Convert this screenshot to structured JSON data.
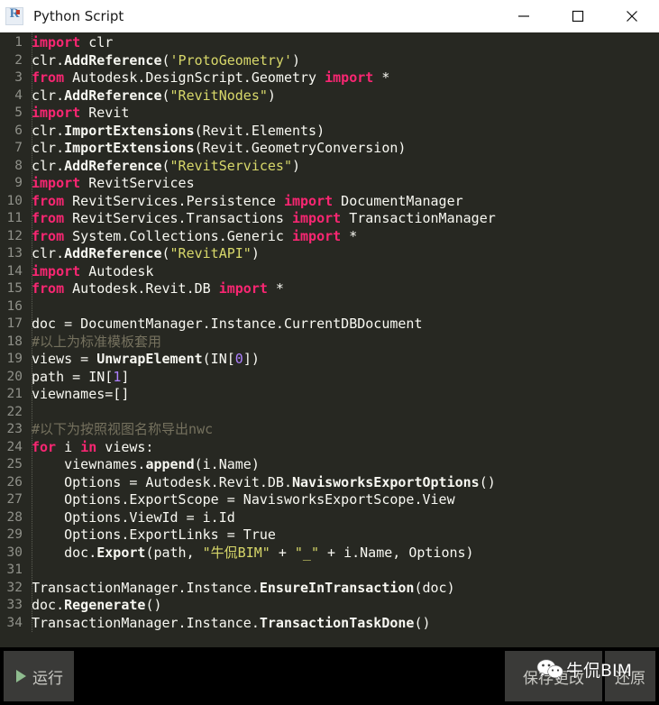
{
  "window": {
    "title": "Python Script",
    "icon": "revit-r-icon",
    "controls": {
      "minimize": "minimize-icon",
      "maximize": "maximize-icon",
      "close": "close-icon"
    }
  },
  "theme": {
    "editor_bg": "#272822",
    "editor_fg": "#f8f8f2",
    "keyword": "#f92672",
    "string": "#d8d86a",
    "number": "#ae81ff",
    "comment": "#75715e",
    "gutter": "#8f9089",
    "bottom_bar_bg": "#000000",
    "button_bg": "#3a3a38",
    "run_arrow": "#8fbc8f"
  },
  "editor": {
    "language": "python",
    "total_lines": 34,
    "lines": [
      {
        "n": "1",
        "tokens": [
          {
            "t": "import",
            "c": "kw"
          },
          {
            "t": " clr",
            "c": "pl"
          }
        ]
      },
      {
        "n": "2",
        "tokens": [
          {
            "t": "clr.",
            "c": "pl"
          },
          {
            "t": "AddReference",
            "c": "fn"
          },
          {
            "t": "(",
            "c": "pl"
          },
          {
            "t": "'ProtoGeometry'",
            "c": "str"
          },
          {
            "t": ")",
            "c": "pl"
          }
        ]
      },
      {
        "n": "3",
        "tokens": [
          {
            "t": "from",
            "c": "kw"
          },
          {
            "t": " Autodesk.DesignScript.Geometry ",
            "c": "pl"
          },
          {
            "t": "import",
            "c": "kw"
          },
          {
            "t": " *",
            "c": "pl"
          }
        ]
      },
      {
        "n": "4",
        "tokens": [
          {
            "t": "clr.",
            "c": "pl"
          },
          {
            "t": "AddReference",
            "c": "fn"
          },
          {
            "t": "(",
            "c": "pl"
          },
          {
            "t": "\"RevitNodes\"",
            "c": "str"
          },
          {
            "t": ")",
            "c": "pl"
          }
        ]
      },
      {
        "n": "5",
        "tokens": [
          {
            "t": "import",
            "c": "kw"
          },
          {
            "t": " Revit",
            "c": "pl"
          }
        ]
      },
      {
        "n": "6",
        "tokens": [
          {
            "t": "clr.",
            "c": "pl"
          },
          {
            "t": "ImportExtensions",
            "c": "fn"
          },
          {
            "t": "(Revit.Elements)",
            "c": "pl"
          }
        ]
      },
      {
        "n": "7",
        "tokens": [
          {
            "t": "clr.",
            "c": "pl"
          },
          {
            "t": "ImportExtensions",
            "c": "fn"
          },
          {
            "t": "(Revit.GeometryConversion)",
            "c": "pl"
          }
        ]
      },
      {
        "n": "8",
        "tokens": [
          {
            "t": "clr.",
            "c": "pl"
          },
          {
            "t": "AddReference",
            "c": "fn"
          },
          {
            "t": "(",
            "c": "pl"
          },
          {
            "t": "\"RevitServices\"",
            "c": "str"
          },
          {
            "t": ")",
            "c": "pl"
          }
        ]
      },
      {
        "n": "9",
        "tokens": [
          {
            "t": "import",
            "c": "kw"
          },
          {
            "t": " RevitServices",
            "c": "pl"
          }
        ]
      },
      {
        "n": "10",
        "tokens": [
          {
            "t": "from",
            "c": "kw"
          },
          {
            "t": " RevitServices.Persistence ",
            "c": "pl"
          },
          {
            "t": "import",
            "c": "kw"
          },
          {
            "t": " DocumentManager",
            "c": "pl"
          }
        ]
      },
      {
        "n": "11",
        "tokens": [
          {
            "t": "from",
            "c": "kw"
          },
          {
            "t": " RevitServices.Transactions ",
            "c": "pl"
          },
          {
            "t": "import",
            "c": "kw"
          },
          {
            "t": " TransactionManager",
            "c": "pl"
          }
        ]
      },
      {
        "n": "12",
        "tokens": [
          {
            "t": "from",
            "c": "kw"
          },
          {
            "t": " System.Collections.Generic ",
            "c": "pl"
          },
          {
            "t": "import",
            "c": "kw"
          },
          {
            "t": " *",
            "c": "pl"
          }
        ]
      },
      {
        "n": "13",
        "tokens": [
          {
            "t": "clr.",
            "c": "pl"
          },
          {
            "t": "AddReference",
            "c": "fn"
          },
          {
            "t": "(",
            "c": "pl"
          },
          {
            "t": "\"RevitAPI\"",
            "c": "str"
          },
          {
            "t": ")",
            "c": "pl"
          }
        ]
      },
      {
        "n": "14",
        "tokens": [
          {
            "t": "import",
            "c": "kw"
          },
          {
            "t": " Autodesk",
            "c": "pl"
          }
        ]
      },
      {
        "n": "15",
        "tokens": [
          {
            "t": "from",
            "c": "kw"
          },
          {
            "t": " Autodesk.Revit.DB ",
            "c": "pl"
          },
          {
            "t": "import",
            "c": "kw"
          },
          {
            "t": " *",
            "c": "pl"
          }
        ]
      },
      {
        "n": "16",
        "tokens": []
      },
      {
        "n": "17",
        "tokens": [
          {
            "t": "doc = DocumentManager.Instance.CurrentDBDocument",
            "c": "pl"
          }
        ]
      },
      {
        "n": "18",
        "tokens": [
          {
            "t": "#以上为标准模板套用",
            "c": "com"
          }
        ]
      },
      {
        "n": "19",
        "tokens": [
          {
            "t": "views = ",
            "c": "pl"
          },
          {
            "t": "UnwrapElement",
            "c": "fn"
          },
          {
            "t": "(IN[",
            "c": "pl"
          },
          {
            "t": "0",
            "c": "num"
          },
          {
            "t": "])",
            "c": "pl"
          }
        ]
      },
      {
        "n": "20",
        "tokens": [
          {
            "t": "path = IN[",
            "c": "pl"
          },
          {
            "t": "1",
            "c": "num"
          },
          {
            "t": "]",
            "c": "pl"
          }
        ]
      },
      {
        "n": "21",
        "tokens": [
          {
            "t": "viewnames=[]",
            "c": "pl"
          }
        ]
      },
      {
        "n": "22",
        "tokens": []
      },
      {
        "n": "23",
        "tokens": [
          {
            "t": "#以下为按照视图名称导出nwc",
            "c": "com"
          }
        ]
      },
      {
        "n": "24",
        "tokens": [
          {
            "t": "for",
            "c": "kw"
          },
          {
            "t": " i ",
            "c": "pl"
          },
          {
            "t": "in",
            "c": "kw"
          },
          {
            "t": " views:",
            "c": "pl"
          }
        ]
      },
      {
        "n": "25",
        "tokens": [
          {
            "t": "    viewnames.",
            "c": "pl"
          },
          {
            "t": "append",
            "c": "fn"
          },
          {
            "t": "(i.Name)",
            "c": "pl"
          }
        ]
      },
      {
        "n": "26",
        "tokens": [
          {
            "t": "    Options = Autodesk.Revit.DB.",
            "c": "pl"
          },
          {
            "t": "NavisworksExportOptions",
            "c": "fn"
          },
          {
            "t": "()",
            "c": "pl"
          }
        ]
      },
      {
        "n": "27",
        "tokens": [
          {
            "t": "    Options.ExportScope = NavisworksExportScope.View",
            "c": "pl"
          }
        ]
      },
      {
        "n": "28",
        "tokens": [
          {
            "t": "    Options.ViewId = i.Id",
            "c": "pl"
          }
        ]
      },
      {
        "n": "29",
        "tokens": [
          {
            "t": "    Options.ExportLinks = True",
            "c": "pl"
          }
        ]
      },
      {
        "n": "30",
        "tokens": [
          {
            "t": "    doc.",
            "c": "pl"
          },
          {
            "t": "Export",
            "c": "fn"
          },
          {
            "t": "(path, ",
            "c": "pl"
          },
          {
            "t": "\"牛侃BIM\"",
            "c": "str"
          },
          {
            "t": " + ",
            "c": "pl"
          },
          {
            "t": "\"_\"",
            "c": "str"
          },
          {
            "t": " + i.Name, Options)",
            "c": "pl"
          }
        ]
      },
      {
        "n": "31",
        "tokens": []
      },
      {
        "n": "32",
        "tokens": [
          {
            "t": "TransactionManager.Instance.",
            "c": "pl"
          },
          {
            "t": "EnsureInTransaction",
            "c": "fn"
          },
          {
            "t": "(doc)",
            "c": "pl"
          }
        ]
      },
      {
        "n": "33",
        "tokens": [
          {
            "t": "doc.",
            "c": "pl"
          },
          {
            "t": "Regenerate",
            "c": "fn"
          },
          {
            "t": "()",
            "c": "pl"
          }
        ]
      },
      {
        "n": "34",
        "tokens": [
          {
            "t": "TransactionManager.Instance.",
            "c": "pl"
          },
          {
            "t": "TransactionTaskDone",
            "c": "fn"
          },
          {
            "t": "()",
            "c": "pl"
          }
        ]
      }
    ]
  },
  "bottom_bar": {
    "run_label": "运行",
    "save_label": "保存更改",
    "revert_label": "还原"
  },
  "watermark": {
    "text": "牛侃BIM",
    "icon": "wechat-icon"
  }
}
